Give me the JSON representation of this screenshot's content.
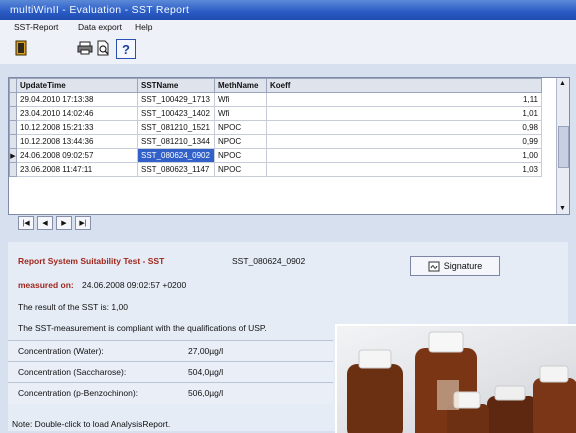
{
  "window": {
    "title": "multiWinII - Evaluation - SST Report"
  },
  "menu": {
    "items": [
      "SST-Report",
      "Data export",
      "Help"
    ]
  },
  "toolbar": {
    "help_label": "?"
  },
  "grid": {
    "columns": [
      "UpdateTime",
      "SSTName",
      "MethName",
      "Koeff"
    ],
    "rows": [
      {
        "time": "29.04.2010 17:13:38",
        "name": "SST_100429_1713",
        "meth": "Wfi",
        "koeff": "1,11"
      },
      {
        "time": "23.04.2010 14:02:46",
        "name": "SST_100423_1402",
        "meth": "Wfi",
        "koeff": "1,01"
      },
      {
        "time": "10.12.2008 15:21:33",
        "name": "SST_081210_1521",
        "meth": "NPOC",
        "koeff": "0,98"
      },
      {
        "time": "10.12.2008 13:44:36",
        "name": "SST_081210_1344",
        "meth": "NPOC",
        "koeff": "0,99"
      },
      {
        "time": "24.06.2008 09:02:57",
        "name": "SST_080624_0902",
        "meth": "NPOC",
        "koeff": "1,00",
        "selected": true
      },
      {
        "time": "23.06.2008 11:47:11",
        "name": "SST_080623_1147",
        "meth": "NPOC",
        "koeff": "1,03"
      }
    ]
  },
  "nav": [
    "first",
    "previous",
    "next",
    "last"
  ],
  "report": {
    "heading": "Report System Suitability Test - SST",
    "sst_name": "SST_080624_0902",
    "measured_label": "measured on:",
    "measured_value": "24.06.2008 09:02:57 +0200",
    "result": "The result of the SST is: 1,00",
    "compliance": "The SST-measurement is compliant with the qualifications of USP.",
    "signature_label": "Signature",
    "concentrations": [
      {
        "label": "Concentration (Water):",
        "value": "27,00µg/l"
      },
      {
        "label": "Concentration (Saccharose):",
        "value": "504,0µg/l"
      },
      {
        "label": "Concentration (p-Benzochinon):",
        "value": "506,0µg/l"
      }
    ],
    "note": "Note: Double-click to load AnalysisReport."
  },
  "colors": {
    "title_bar": "#2a5bc4",
    "selection": "#3160c8",
    "heading_red": "#a0261c",
    "bottle_brown": "#6b2f12"
  }
}
